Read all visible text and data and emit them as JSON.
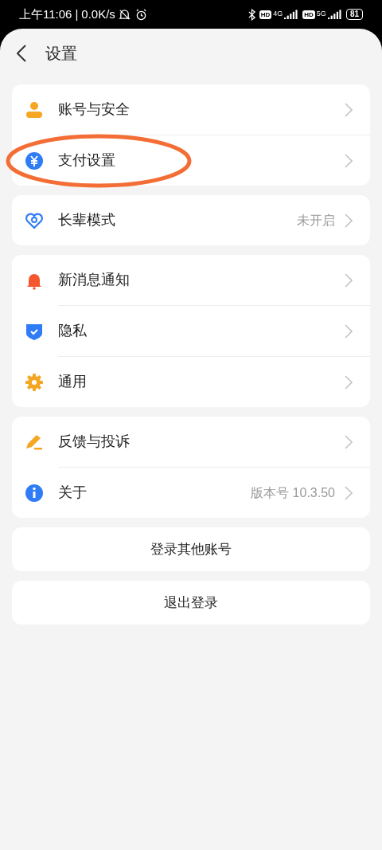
{
  "status_bar": {
    "time": "上午11:06",
    "separator": "|",
    "speed": "0.0K/s",
    "sims": [
      {
        "hd": "HD",
        "network": "4G"
      },
      {
        "hd": "HD",
        "network": "5G"
      }
    ],
    "battery": "81"
  },
  "header": {
    "title": "设置"
  },
  "groups": [
    {
      "items": [
        {
          "label": "账号与安全",
          "circled": false
        },
        {
          "label": "支付设置",
          "circled": true
        }
      ]
    },
    {
      "items": [
        {
          "label": "长辈模式",
          "value": "未开启",
          "circled": false
        }
      ]
    },
    {
      "items": [
        {
          "label": "新消息通知",
          "circled": false
        },
        {
          "label": "隐私",
          "circled": false
        },
        {
          "label": "通用",
          "circled": false
        }
      ]
    },
    {
      "items": [
        {
          "label": "反馈与投诉",
          "circled": false
        },
        {
          "label": "关于",
          "value": "版本号 10.3.50",
          "circled": false
        }
      ]
    }
  ],
  "buttons": [
    "登录其他账号",
    "退出登录"
  ]
}
